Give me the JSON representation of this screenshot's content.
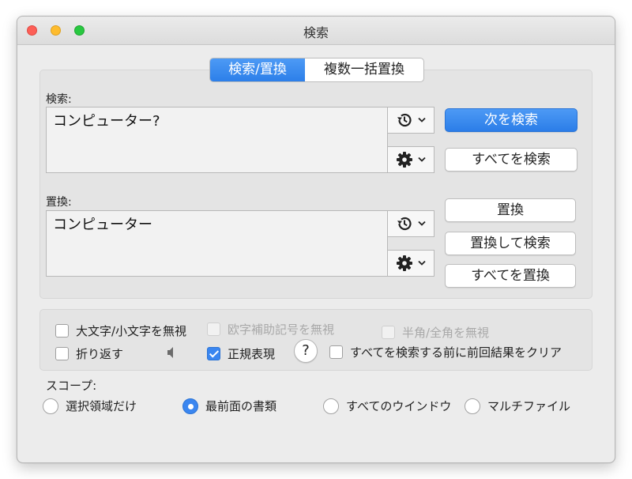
{
  "window": {
    "title": "検索"
  },
  "tabs": [
    {
      "label": "検索/置換",
      "active": true
    },
    {
      "label": "複数一括置換",
      "active": false
    }
  ],
  "search": {
    "label": "検索:",
    "value": "コンピューター?",
    "next_button": "次を検索",
    "all_button": "すべてを検索"
  },
  "replace": {
    "label": "置換:",
    "value": "コンピューター",
    "replace_button": "置換",
    "replace_find_button": "置換して検索",
    "replace_all_button": "すべてを置換"
  },
  "options": {
    "case_insensitive": {
      "label": "大文字/小文字を無視",
      "checked": false,
      "enabled": true
    },
    "ignore_diacritics": {
      "label": "欧字補助記号を無視",
      "checked": false,
      "enabled": false
    },
    "ignore_width": {
      "label": "半角/全角を無視",
      "checked": false,
      "enabled": false
    },
    "wrap": {
      "label": "折り返す",
      "checked": false,
      "enabled": true
    },
    "regex": {
      "label": "正規表現",
      "checked": true,
      "enabled": true
    },
    "help": "?",
    "clear_before": {
      "label": "すべてを検索する前に前回結果をクリア",
      "checked": false,
      "enabled": true
    }
  },
  "scope": {
    "label": "スコープ:",
    "items": [
      {
        "label": "選択領域だけ",
        "selected": false
      },
      {
        "label": "最前面の書類",
        "selected": true
      },
      {
        "label": "すべてのウインドウ",
        "selected": false
      },
      {
        "label": "マルチファイル",
        "selected": false
      }
    ]
  },
  "colors": {
    "accent": "#3a86f0",
    "close": "#fd5f57",
    "minimize": "#febc2e",
    "maximize": "#28c840"
  }
}
